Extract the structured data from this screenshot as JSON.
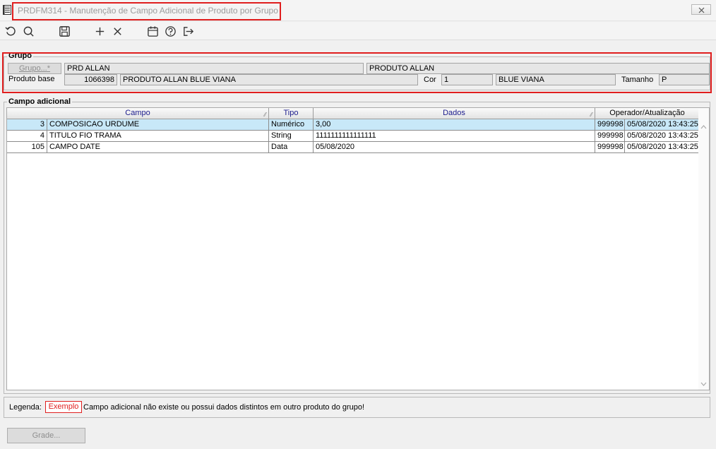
{
  "window": {
    "title": "PRDFM314 - Manutenção de Campo Adicional de Produto por Grupo",
    "close_glyph": "✕"
  },
  "toolbar": {
    "buttons": [
      {
        "name": "refresh-icon"
      },
      {
        "name": "search-icon"
      },
      {
        "name": "save-icon"
      },
      {
        "name": "add-icon"
      },
      {
        "name": "delete-icon"
      },
      {
        "name": "calendar-icon"
      },
      {
        "name": "help-icon"
      },
      {
        "name": "exit-icon"
      }
    ]
  },
  "grupo": {
    "section_label": "Grupo",
    "grupo_button": "Grupo...*",
    "grupo_code": "PRD ALLAN",
    "grupo_desc": "PRODUTO ALLAN",
    "produto_base_label": "Produto base",
    "produto_base_code": "1066398",
    "produto_base_desc": "PRODUTO ALLAN BLUE VIANA",
    "cor_label": "Cor",
    "cor_code": "1",
    "cor_desc": "BLUE VIANA",
    "tamanho_label": "Tamanho",
    "tamanho_value": "P"
  },
  "campo": {
    "section_label": "Campo adicional",
    "columns": {
      "campo": "Campo",
      "tipo": "Tipo",
      "dados": "Dados",
      "operador": "Operador/Atualização"
    },
    "rows": [
      {
        "id": "3",
        "campo": "COMPOSICAO URDUME",
        "tipo": "Numérico",
        "dados": "3,00",
        "operador": "999998",
        "atualizacao": "05/08/2020 13:43:25"
      },
      {
        "id": "4",
        "campo": "TITULO FIO TRAMA",
        "tipo": "String",
        "dados": "1111111111111111",
        "operador": "999998",
        "atualizacao": "05/08/2020 13:43:25"
      },
      {
        "id": "105",
        "campo": "CAMPO DATE",
        "tipo": "Data",
        "dados": "05/08/2020",
        "operador": "999998",
        "atualizacao": "05/08/2020 13:43:25"
      }
    ]
  },
  "legend": {
    "label": "Legenda:",
    "example": "Exemplo",
    "text": "Campo adicional não existe ou possui dados distintos em outro produto do grupo!",
    "example_color": "#e01e1e"
  },
  "footer": {
    "grade_button": "Grade..."
  },
  "colors": {
    "highlight": "#e01e1e",
    "selected_row": "#c8e8f8",
    "header_text": "#1a1a8c"
  }
}
